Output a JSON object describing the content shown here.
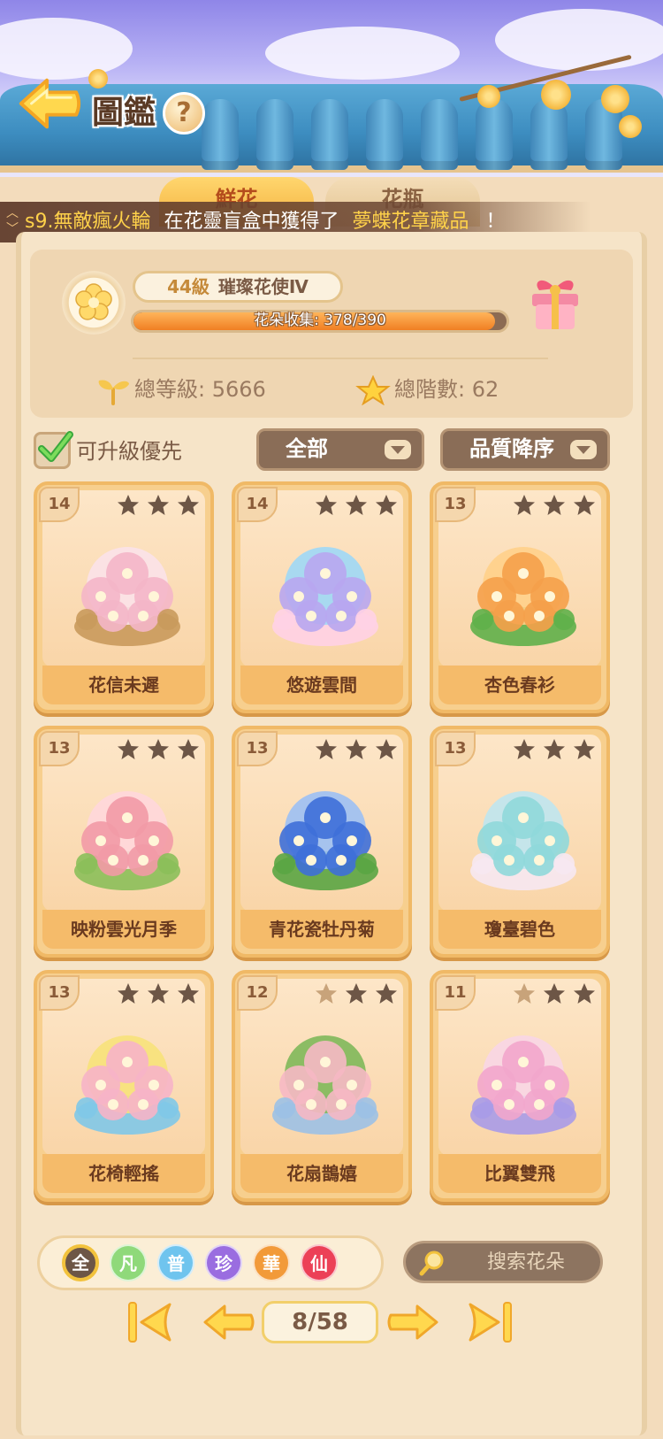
{
  "header": {
    "title": "圖鑑",
    "help": "?"
  },
  "tabs": [
    {
      "label": "鮮花"
    },
    {
      "label": "花瓶"
    }
  ],
  "ticker": {
    "player": "s9.無敵瘋火輪",
    "middle": "在花靈盲盒中獲得了",
    "item": "夢蝶花章藏品",
    "end": "！"
  },
  "profile": {
    "level_text": "44級",
    "title": "璀璨花使Ⅳ",
    "collection_text": "花朵收集: 378/390",
    "collection_progress": 0.969,
    "total_level_text": "總等級: 5666",
    "total_stars_text": "總階數: 62"
  },
  "filters": {
    "upgradable_first_label": "可升級優先",
    "upgradable_first_checked": true,
    "category_value": "全部",
    "sort_value": "品質降序"
  },
  "cards": [
    {
      "level": "14",
      "stars_filled": 3,
      "name": "花信未遲",
      "palette": [
        "#f4b6c8",
        "#c99a5c",
        "#fbe2e9"
      ]
    },
    {
      "level": "14",
      "stars_filled": 3,
      "name": "悠遊雲間",
      "palette": [
        "#b8a6f0",
        "#ffd2e6",
        "#9ed8f6"
      ]
    },
    {
      "level": "13",
      "stars_filled": 3,
      "name": "杏色春衫",
      "palette": [
        "#f5a04a",
        "#5fb04a",
        "#ffd08a"
      ]
    },
    {
      "level": "13",
      "stars_filled": 3,
      "name": "映粉雲光月季",
      "palette": [
        "#f29aa6",
        "#8bbf5a",
        "#ffd7dc"
      ]
    },
    {
      "level": "13",
      "stars_filled": 3,
      "name": "青花瓷牡丹菊",
      "palette": [
        "#3e6fd8",
        "#5aa544",
        "#9cc0f4"
      ]
    },
    {
      "level": "13",
      "stars_filled": 3,
      "name": "瓊臺碧色",
      "palette": [
        "#8fd8da",
        "#f6e8f2",
        "#bfe6f0"
      ]
    },
    {
      "level": "13",
      "stars_filled": 3,
      "name": "花椅輕搖",
      "palette": [
        "#f6b4c8",
        "#7fc8e8",
        "#f7e27a"
      ]
    },
    {
      "level": "12",
      "stars_filled": 2,
      "name": "花扇鵲嬉",
      "palette": [
        "#f6b8c4",
        "#9cc1e6",
        "#7fb85a"
      ]
    },
    {
      "level": "11",
      "stars_filled": 2,
      "name": "比翼雙飛",
      "palette": [
        "#f2a6cc",
        "#a99be8",
        "#f8d6e6"
      ]
    }
  ],
  "rarity_filters": [
    "全",
    "凡",
    "普",
    "珍",
    "華",
    "仙"
  ],
  "search": {
    "placeholder": "搜索花朵"
  },
  "pagination": {
    "text": "8/58"
  },
  "colors": {
    "accent": "#f4b13e",
    "panel": "#f6e4c8",
    "star_filled": "#6d5646",
    "star_empty": "#c8a37a"
  }
}
